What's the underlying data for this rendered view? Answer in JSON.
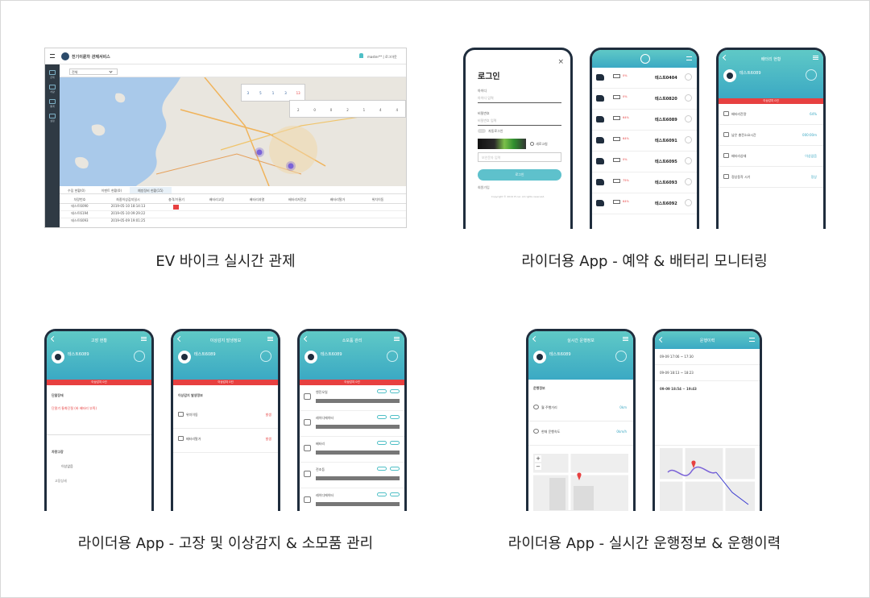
{
  "captions": {
    "c1": "EV 바이크 실시간 관제",
    "c2": "라이더용 App - 예약 & 배터리 모니터링",
    "c3": "라이더용 App - 고장 및 이상감지 & 소모품 관리",
    "c4": "라이더용 App - 실시간 운행정보 & 운행이력"
  },
  "desktop": {
    "title": "전기이륜차 관제서비스",
    "user": "master** | 로그아웃",
    "filter": "전체",
    "stats1": [
      "3",
      "5",
      "1",
      "3",
      "13"
    ],
    "stats2": [
      "2",
      "0",
      "0",
      "2",
      "1",
      "4",
      "4"
    ],
    "tabs": [
      "수집 현황(0)",
      "이벤트 현황(0)",
      "예방정비 현황(15)"
    ],
    "table_headers": [
      "차량번호",
      "최종이상감지일시",
      "충격/기울기",
      "배터리고장",
      "배터리과열",
      "배터리저전압",
      "배터리탈거",
      "위치이동"
    ],
    "rows": [
      [
        "테스트6090",
        "2019-05-10 18:14:13"
      ],
      [
        "테스트6194",
        "2019-05-10 09:29:22"
      ],
      [
        "테스트6093",
        "2019-05-09 19:01:25"
      ]
    ]
  },
  "login": {
    "title": "로그인",
    "id_label": "아이디",
    "id_placeholder": "아이디 입력",
    "pw_label": "비밀번호",
    "pw_placeholder": "비밀번호 입력",
    "auto_login": "자동로그인",
    "refresh": "새로고침",
    "captcha_placeholder": "보안문자 입력",
    "button": "로그인",
    "find": "회원가입",
    "copyright": "Copyright © 2019 IT-car. All rights reserved."
  },
  "booking_list": {
    "items": [
      {
        "pct": "0%",
        "plate": "테스트0404"
      },
      {
        "pct": "0%",
        "plate": "테스트0820"
      },
      {
        "pct": "64%",
        "plate": "테스트6089"
      },
      {
        "pct": "64%",
        "plate": "테스트6091"
      },
      {
        "pct": "0%",
        "plate": "테스트6095"
      },
      {
        "pct": "75%",
        "plate": "테스트6093"
      },
      {
        "pct": "64%",
        "plate": "테스트6092"
      }
    ]
  },
  "battery": {
    "title": "배터리 현황",
    "plate": "테스트6089",
    "alert": "이상감지 0건",
    "rows": [
      {
        "label": "배터리잔량",
        "value": "64%"
      },
      {
        "label": "남은 충전소요시간",
        "value": "000:00m"
      },
      {
        "label": "배터리상태",
        "value": "이상없음"
      },
      {
        "label": "정상동작 시기",
        "value": "정상"
      }
    ]
  },
  "fault": {
    "title": "고장 현황",
    "plate": "테스트6089",
    "alert": "이상감지 0건",
    "section1": "단말장애",
    "item1": "단말기 통화단절 (바 배터리 부족)",
    "section2": "차량고장",
    "item2": "이상없음",
    "more": "고장상세"
  },
  "anomaly": {
    "title": "이상감지 발생정보",
    "plate": "테스트6089",
    "alert": "이상감지 0건",
    "section": "이상감지 발생정보",
    "rows": [
      {
        "label": "위치이동",
        "value": "발생"
      },
      {
        "label": "배터리탈거",
        "value": "발생"
      }
    ]
  },
  "consumables": {
    "title": "소모품 관리",
    "plate": "테스트6089",
    "alert": "이상감지 0건",
    "rows": [
      "엔진오일",
      "레이디에이터",
      "배터리",
      "전조등",
      "레이디에이터"
    ]
  },
  "drive": {
    "title": "실시간 운행정보",
    "plate": "테스트6089",
    "section": "운행정보",
    "rows": [
      {
        "label": "월 주행거리",
        "value": "0km"
      },
      {
        "label": "현재 운행속도",
        "value": "0km/h"
      }
    ]
  },
  "history": {
    "title": "운행이력",
    "entries": [
      "09-09 17:06 ~ 17:30",
      "09-09 18:13 ~ 18:23",
      "09-09 18:54 ~ 19:43"
    ]
  },
  "colors": {
    "teal": "#4fbfc6",
    "navy": "#1f2d3d",
    "red": "#e74040",
    "purple": "#7b63d8"
  }
}
